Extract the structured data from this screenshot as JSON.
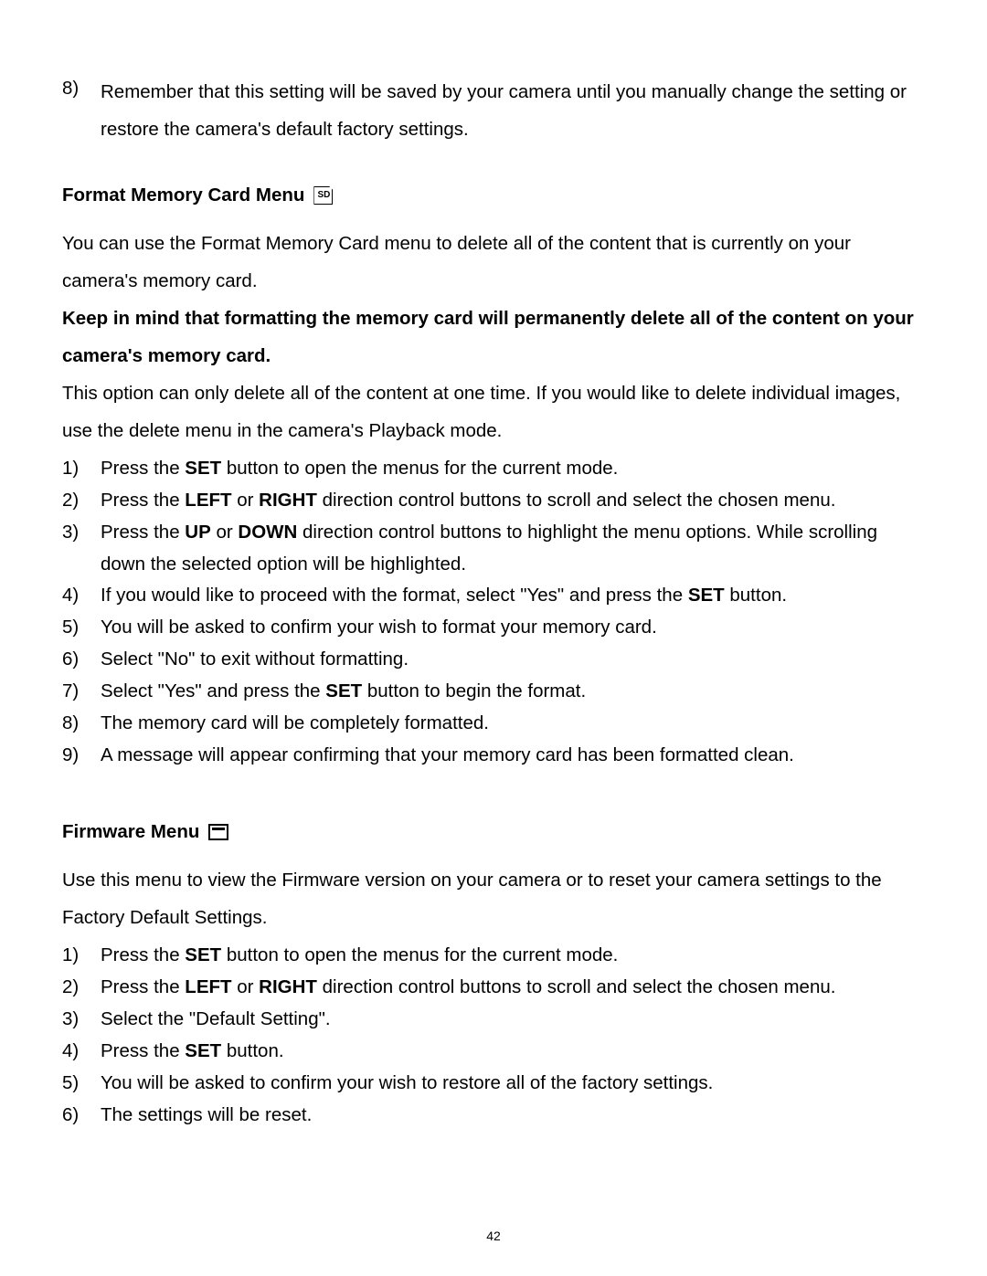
{
  "pageNumber": "42",
  "top": {
    "num": "8)",
    "text": "Remember that this setting will be saved by your camera until you manually change the setting or restore the camera's default factory settings."
  },
  "format": {
    "heading": "Format Memory Card Menu",
    "iconName": "sd-card-icon",
    "sdLabel": "SD",
    "p1": "You can use the Format Memory Card menu to delete all of the content that is currently on your camera's memory card.",
    "warning": "Keep in mind that formatting the memory card will permanently delete all of the content on your camera's memory card.",
    "p2": "This option can only delete all of the content at one time. If you would like to delete individual images, use the delete menu in the camera's Playback mode.",
    "steps": [
      {
        "num": "1)",
        "pre": "Press the ",
        "b1": "SET",
        "post": " button to open the menus for the current mode."
      },
      {
        "num": "2)",
        "pre": "Press the ",
        "b1": "LEFT",
        "mid": " or ",
        "b2": "RIGHT",
        "post": " direction control buttons to scroll and select the chosen menu."
      },
      {
        "num": "3)",
        "pre": "Press the ",
        "b1": "UP",
        "mid": " or ",
        "b2": "DOWN",
        "post": " direction control buttons to highlight the menu options. While scrolling down the selected option will be highlighted."
      },
      {
        "num": "4)",
        "pre": "If you would like to proceed with the format, select \"Yes\" and press the ",
        "b1": "SET",
        "post": " button."
      },
      {
        "num": "5)",
        "plain": "You will be asked to confirm your wish to format your memory card."
      },
      {
        "num": "6)",
        "plain": "Select \"No\" to exit without formatting."
      },
      {
        "num": "7)",
        "pre": "Select \"Yes\" and press the ",
        "b1": "SET",
        "post": " button to begin the format."
      },
      {
        "num": "8)",
        "plain": "The memory card will be completely formatted."
      },
      {
        "num": "9)",
        "plain": "A message will appear confirming that your memory card has been formatted clean."
      }
    ]
  },
  "firmware": {
    "heading": "Firmware Menu",
    "iconName": "firmware-icon",
    "p1": "Use this menu to view the Firmware version on your camera or to reset your camera settings to the Factory Default Settings.",
    "steps": [
      {
        "num": "1)",
        "pre": "Press the ",
        "b1": "SET",
        "post": " button to open the menus for the current mode."
      },
      {
        "num": "2)",
        "pre": "Press the ",
        "b1": "LEFT",
        "mid": " or ",
        "b2": "RIGHT",
        "post": " direction control buttons to scroll and select the chosen menu."
      },
      {
        "num": "3)",
        "plain": "Select the \"Default Setting\"."
      },
      {
        "num": "4)",
        "pre": "Press the ",
        "b1": "SET",
        "post": " button."
      },
      {
        "num": "5)",
        "plain": "You will be asked to confirm your wish to restore all of the factory settings."
      },
      {
        "num": "6)",
        "plain": "The settings will be reset."
      }
    ]
  }
}
